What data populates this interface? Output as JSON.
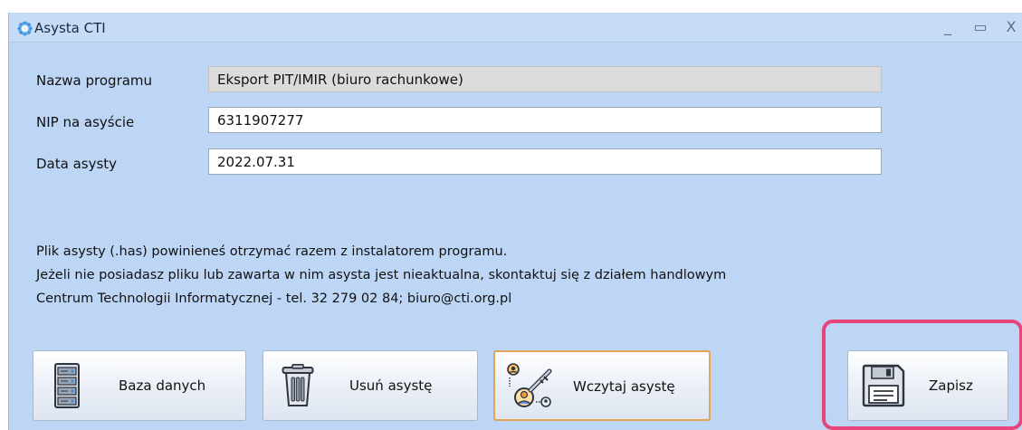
{
  "window": {
    "title": "Asysta CTI",
    "controls": {
      "minimize": "_",
      "maximize": "▭",
      "close": "X"
    }
  },
  "form": {
    "program_name": {
      "label": "Nazwa programu",
      "value": "Eksport PIT/IMIR (biuro rachunkowe)"
    },
    "nip": {
      "label": "NIP na asyście",
      "value": "6311907277"
    },
    "date": {
      "label": "Data asysty",
      "value": "2022.07.31"
    }
  },
  "info": {
    "line1": "Plik asysty (.has) powinieneś otrzymać razem z instalatorem programu.",
    "line2": "Jeżeli nie posiadasz pliku lub zawarta w nim asysta jest nieaktualna, skontaktuj się z działem handlowym",
    "line3": "Centrum Technologii Informatycznej - tel. 32 279 02 84; biuro@cti.org.pl"
  },
  "buttons": {
    "database": {
      "label": "Baza danych",
      "icon": "server-rack-icon"
    },
    "remove": {
      "label": "Usuń asystę",
      "icon": "trash-icon"
    },
    "load": {
      "label": "Wczytaj asystę",
      "icon": "key-users-icon"
    },
    "save": {
      "label": "Zapisz",
      "icon": "floppy-disk-icon"
    }
  },
  "colors": {
    "window_bg": "#bdd6f5",
    "highlight": "#e8457a",
    "active_button_border": "#e2a35a"
  }
}
